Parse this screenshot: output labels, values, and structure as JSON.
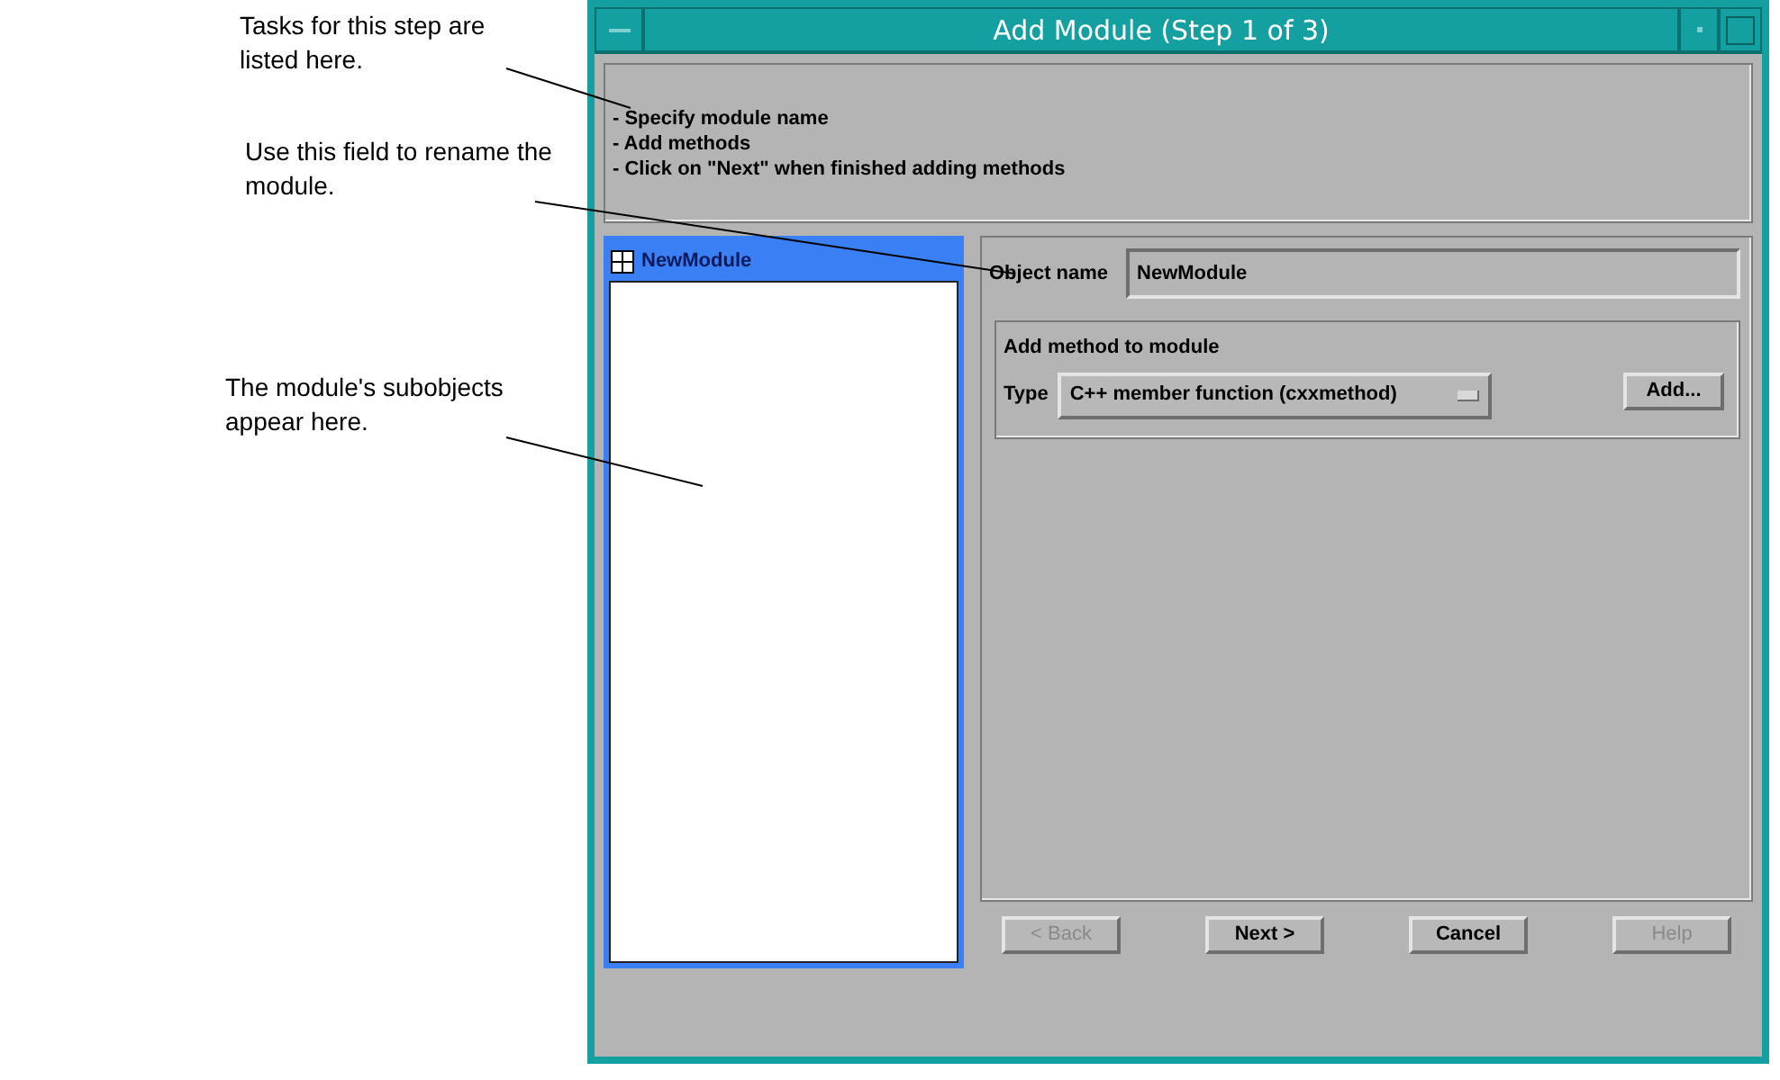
{
  "annotations": [
    {
      "text": "Tasks for this step are listed here."
    },
    {
      "text": "Use this field to rename the module."
    },
    {
      "text": "The module's subobjects appear here."
    }
  ],
  "window": {
    "title": "Add Module (Step 1 of 3)"
  },
  "tasks": [
    "- Specify module name",
    "- Add methods",
    "- Click on \"Next\" when finished adding methods"
  ],
  "tree": {
    "items": [
      {
        "label": "NewModule",
        "selected": true
      }
    ]
  },
  "object_name": {
    "label": "Object name",
    "value": "NewModule"
  },
  "method_group": {
    "title": "Add method to module",
    "type_label": "Type",
    "type_value": "C++ member function (cxxmethod)",
    "add_button": "Add..."
  },
  "buttons": [
    {
      "label": "< Back",
      "disabled": true
    },
    {
      "label": "Next >",
      "disabled": false
    },
    {
      "label": "Cancel",
      "disabled": false
    },
    {
      "label": "Help",
      "disabled": true
    }
  ]
}
